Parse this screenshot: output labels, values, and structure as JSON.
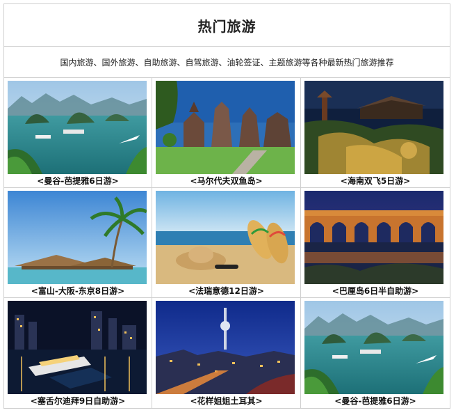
{
  "header": {
    "title": "热门旅游"
  },
  "subtitle": "国内旅游、国外旅游、自助旅游、自驾旅游、油轮签证、主题旅游等各种最新热门旅游推荐",
  "tours": [
    {
      "caption": "<曼谷-芭提雅6日游>",
      "scene": "halong-bay"
    },
    {
      "caption": "<马尔代夫双鱼岛>",
      "scene": "bali-temple"
    },
    {
      "caption": "<海南双飞5日游>",
      "scene": "kyoto-temple-night"
    },
    {
      "caption": "<富山-大阪-东京8日游>",
      "scene": "palm-beach-villas"
    },
    {
      "caption": "<法瑞意德12日游>",
      "scene": "beach-hat-sandals"
    },
    {
      "caption": "<巴厘岛6日半自助游>",
      "scene": "roman-aqueduct"
    },
    {
      "caption": "<塞舌尔迪拜9日自助游>",
      "scene": "harbor-night-ship"
    },
    {
      "caption": "<花样姐姐土耳其>",
      "scene": "berlin-tv-tower"
    },
    {
      "caption": "<曼谷-芭提雅6日游>",
      "scene": "halong-bay"
    }
  ]
}
